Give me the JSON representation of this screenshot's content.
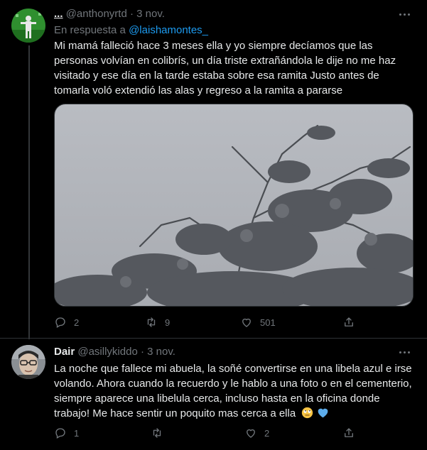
{
  "tweets": [
    {
      "display_name": "...",
      "handle": "@anthonyrtd",
      "separator": "·",
      "time": "3 nov.",
      "reply_prefix": "En respuesta a",
      "reply_mention": "@laishamontes_",
      "text": "Mi mamá falleció hace 3 meses ella y yo siempre decíamos que las personas volvían en colibrís, un día triste extrañándola le dije no me haz visitado y ese día en la tarde estaba sobre esa ramita Justo antes de tomarla voló extendió las alas y regreso a la ramita a pararse",
      "media_description": "tree branches against a grey sky",
      "counts": {
        "replies": "2",
        "retweets": "9",
        "likes": "501"
      },
      "avatar_colors": {
        "bg": "#2f8f2f",
        "figure": "#e8e8e8"
      }
    },
    {
      "display_name": "Dair",
      "handle": "@asillykiddo",
      "separator": "·",
      "time": "3 nov.",
      "text": "La noche que fallece mi abuela, la soñé convertirse en una libela azul e irse volando. Ahora cuando la recuerdo y le hablo a una foto o en el cementerio, siempre aparece una libelula cerca, incluso hasta en la oficina donde trabajo! Me hace sentir un poquito mas cerca a ella",
      "emojis": [
        "face-with-rolling-eyes",
        "blue-heart"
      ],
      "counts": {
        "replies": "1",
        "retweets": "",
        "likes": "2"
      }
    }
  ],
  "colors": {
    "background": "#000000",
    "text": "#e7e9ea",
    "secondary": "#71767b",
    "accent": "#1d9bf0",
    "divider": "#2f3336"
  }
}
